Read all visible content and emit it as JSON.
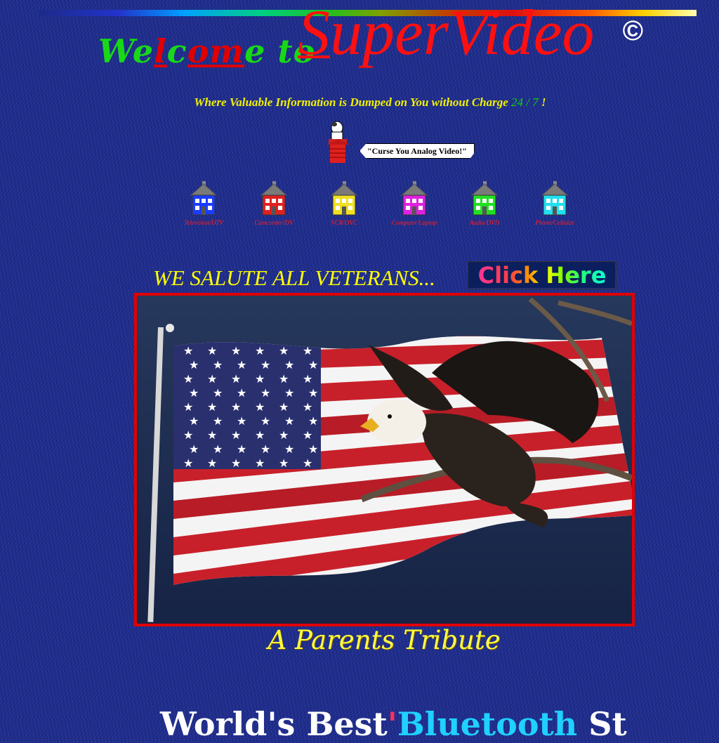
{
  "header": {
    "welcome_pre": "We",
    "welcome_l": "l",
    "welcome_c": "c",
    "welcome_o": "o",
    "welcome_m": "m",
    "welcome_post": "e to",
    "brand_first": "S",
    "brand_rest": "uperVideo",
    "copyright": "©",
    "tagline_text": "Where Valuable Information is Dumped on You without Charge",
    "tagline_24": "24",
    "tagline_slash": "/",
    "tagline_7": "7",
    "tagline_bang": "!"
  },
  "mascot": {
    "bubble": "\"Curse You Analog Video!\""
  },
  "nav": {
    "items": [
      {
        "label": "Television/DTV",
        "color": "#1a3cff"
      },
      {
        "label": "Camcorder/DV",
        "color": "#e02020"
      },
      {
        "label": "VCR/DVC",
        "color": "#f0e020"
      },
      {
        "label": "Computer/Laptop",
        "color": "#e020e0"
      },
      {
        "label": "Audio/DVD",
        "color": "#20e020"
      },
      {
        "label": "Phone/Cellular",
        "color": "#20e0f0"
      }
    ]
  },
  "salute": {
    "text": "WE SALUTE ALL VETERANS...",
    "click": "Click Here"
  },
  "tribute": {
    "text": "A Parents Tribute"
  },
  "footer": {
    "part1": "World's Best",
    "part2": "'",
    "part3": "Bluetooth",
    "part4": " St"
  },
  "colors": {
    "background": "#1c2a8a",
    "accent": "#ff1010",
    "highlight": "#ffff00"
  }
}
